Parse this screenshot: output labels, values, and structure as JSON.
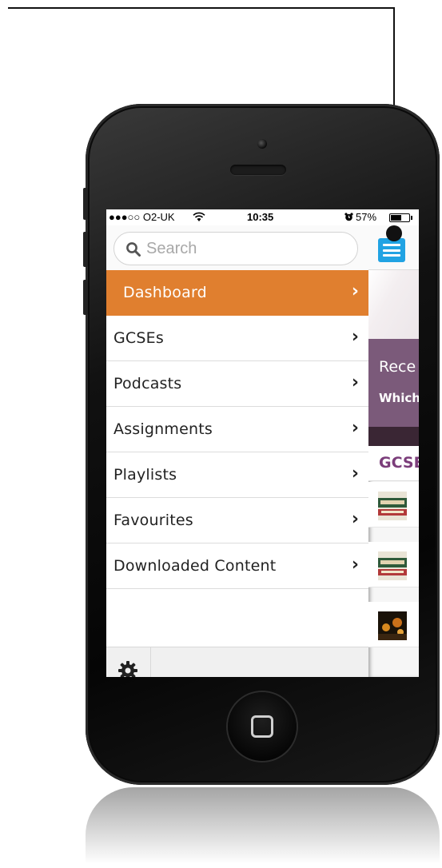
{
  "status_bar": {
    "signal": "●●●○○ O2-UK",
    "wifi": "wifi-icon",
    "time": "10:35",
    "alarm": "alarm-icon",
    "battery_pct": "57%",
    "battery_level": 0.57
  },
  "search": {
    "placeholder": "Search"
  },
  "menu": {
    "items": [
      {
        "label": "Dashboard",
        "chevron": "›",
        "active": true
      },
      {
        "label": "GCSEs",
        "chevron": "›"
      },
      {
        "label": "Podcasts",
        "chevron": "›"
      },
      {
        "label": "Assignments",
        "chevron": "›"
      },
      {
        "label": "Playlists",
        "chevron": "›"
      },
      {
        "label": "Favourites",
        "chevron": "›"
      },
      {
        "label": "Downloaded Content",
        "chevron": "›"
      }
    ],
    "active_color": "#e07f2f"
  },
  "bottom_bar": {
    "settings_icon": "gear-icon"
  },
  "content_peek": {
    "menu_button_icon": "hamburger-menu-icon",
    "menu_button_color": "#21a3e3",
    "banner_title": "Rece",
    "banner_subtitle": "Which",
    "banner_color": "#7b5a7a",
    "section_title": "GCSE",
    "section_color": "#7b3d7a"
  }
}
